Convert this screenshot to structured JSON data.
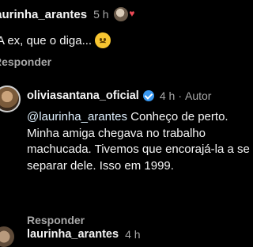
{
  "comments": [
    {
      "username": "laurinha_arantes",
      "time": "5 h",
      "text": "A ex, que o diga...",
      "reply_label": "Responder",
      "icons": [
        "author-avatar-icon",
        "heart-icon",
        "worried-face-emoji"
      ]
    },
    {
      "username": "oliviasantana_oficial",
      "time": "4 h",
      "author_badge": "Autor",
      "mention": "@laurinha_arantes",
      "text": "Conheço de perto. Minha amiga chegava no trabalho machucada. Tivemos que encorajá-la a se separar dele. Isso em 1999.",
      "reply_label": "Responder",
      "icons": [
        "verified-icon"
      ]
    },
    {
      "username": "laurinha_arantes",
      "time": "4 h"
    }
  ],
  "colors": {
    "background": "#000000",
    "text": "#f5f5f5",
    "muted": "#a8a8a8",
    "mention": "#e0f1ff",
    "verified": "#3897f0",
    "heart": "#ed4956"
  }
}
